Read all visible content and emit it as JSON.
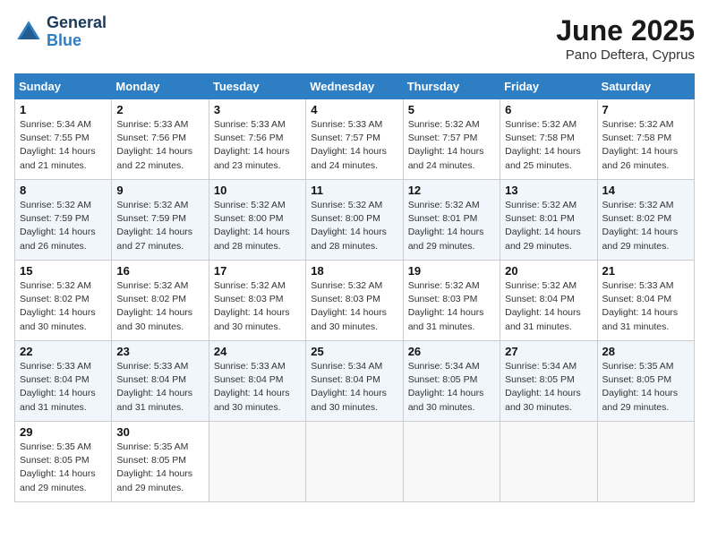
{
  "header": {
    "logo_general": "General",
    "logo_blue": "Blue",
    "month_year": "June 2025",
    "location": "Pano Deftera, Cyprus"
  },
  "weekdays": [
    "Sunday",
    "Monday",
    "Tuesday",
    "Wednesday",
    "Thursday",
    "Friday",
    "Saturday"
  ],
  "weeks": [
    [
      {
        "day": "1",
        "info": "Sunrise: 5:34 AM\nSunset: 7:55 PM\nDaylight: 14 hours\nand 21 minutes."
      },
      {
        "day": "2",
        "info": "Sunrise: 5:33 AM\nSunset: 7:56 PM\nDaylight: 14 hours\nand 22 minutes."
      },
      {
        "day": "3",
        "info": "Sunrise: 5:33 AM\nSunset: 7:56 PM\nDaylight: 14 hours\nand 23 minutes."
      },
      {
        "day": "4",
        "info": "Sunrise: 5:33 AM\nSunset: 7:57 PM\nDaylight: 14 hours\nand 24 minutes."
      },
      {
        "day": "5",
        "info": "Sunrise: 5:32 AM\nSunset: 7:57 PM\nDaylight: 14 hours\nand 24 minutes."
      },
      {
        "day": "6",
        "info": "Sunrise: 5:32 AM\nSunset: 7:58 PM\nDaylight: 14 hours\nand 25 minutes."
      },
      {
        "day": "7",
        "info": "Sunrise: 5:32 AM\nSunset: 7:58 PM\nDaylight: 14 hours\nand 26 minutes."
      }
    ],
    [
      {
        "day": "8",
        "info": "Sunrise: 5:32 AM\nSunset: 7:59 PM\nDaylight: 14 hours\nand 26 minutes."
      },
      {
        "day": "9",
        "info": "Sunrise: 5:32 AM\nSunset: 7:59 PM\nDaylight: 14 hours\nand 27 minutes."
      },
      {
        "day": "10",
        "info": "Sunrise: 5:32 AM\nSunset: 8:00 PM\nDaylight: 14 hours\nand 28 minutes."
      },
      {
        "day": "11",
        "info": "Sunrise: 5:32 AM\nSunset: 8:00 PM\nDaylight: 14 hours\nand 28 minutes."
      },
      {
        "day": "12",
        "info": "Sunrise: 5:32 AM\nSunset: 8:01 PM\nDaylight: 14 hours\nand 29 minutes."
      },
      {
        "day": "13",
        "info": "Sunrise: 5:32 AM\nSunset: 8:01 PM\nDaylight: 14 hours\nand 29 minutes."
      },
      {
        "day": "14",
        "info": "Sunrise: 5:32 AM\nSunset: 8:02 PM\nDaylight: 14 hours\nand 29 minutes."
      }
    ],
    [
      {
        "day": "15",
        "info": "Sunrise: 5:32 AM\nSunset: 8:02 PM\nDaylight: 14 hours\nand 30 minutes."
      },
      {
        "day": "16",
        "info": "Sunrise: 5:32 AM\nSunset: 8:02 PM\nDaylight: 14 hours\nand 30 minutes."
      },
      {
        "day": "17",
        "info": "Sunrise: 5:32 AM\nSunset: 8:03 PM\nDaylight: 14 hours\nand 30 minutes."
      },
      {
        "day": "18",
        "info": "Sunrise: 5:32 AM\nSunset: 8:03 PM\nDaylight: 14 hours\nand 30 minutes."
      },
      {
        "day": "19",
        "info": "Sunrise: 5:32 AM\nSunset: 8:03 PM\nDaylight: 14 hours\nand 31 minutes."
      },
      {
        "day": "20",
        "info": "Sunrise: 5:32 AM\nSunset: 8:04 PM\nDaylight: 14 hours\nand 31 minutes."
      },
      {
        "day": "21",
        "info": "Sunrise: 5:33 AM\nSunset: 8:04 PM\nDaylight: 14 hours\nand 31 minutes."
      }
    ],
    [
      {
        "day": "22",
        "info": "Sunrise: 5:33 AM\nSunset: 8:04 PM\nDaylight: 14 hours\nand 31 minutes."
      },
      {
        "day": "23",
        "info": "Sunrise: 5:33 AM\nSunset: 8:04 PM\nDaylight: 14 hours\nand 31 minutes."
      },
      {
        "day": "24",
        "info": "Sunrise: 5:33 AM\nSunset: 8:04 PM\nDaylight: 14 hours\nand 30 minutes."
      },
      {
        "day": "25",
        "info": "Sunrise: 5:34 AM\nSunset: 8:04 PM\nDaylight: 14 hours\nand 30 minutes."
      },
      {
        "day": "26",
        "info": "Sunrise: 5:34 AM\nSunset: 8:05 PM\nDaylight: 14 hours\nand 30 minutes."
      },
      {
        "day": "27",
        "info": "Sunrise: 5:34 AM\nSunset: 8:05 PM\nDaylight: 14 hours\nand 30 minutes."
      },
      {
        "day": "28",
        "info": "Sunrise: 5:35 AM\nSunset: 8:05 PM\nDaylight: 14 hours\nand 29 minutes."
      }
    ],
    [
      {
        "day": "29",
        "info": "Sunrise: 5:35 AM\nSunset: 8:05 PM\nDaylight: 14 hours\nand 29 minutes."
      },
      {
        "day": "30",
        "info": "Sunrise: 5:35 AM\nSunset: 8:05 PM\nDaylight: 14 hours\nand 29 minutes."
      },
      null,
      null,
      null,
      null,
      null
    ]
  ]
}
